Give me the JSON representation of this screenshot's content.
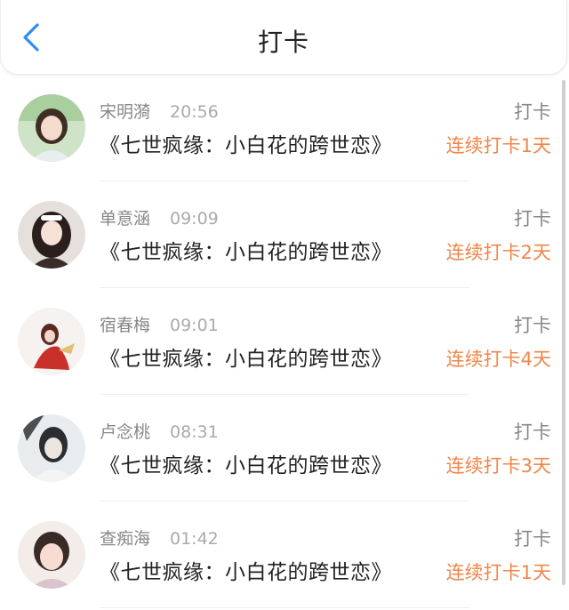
{
  "header": {
    "title": "打卡",
    "back_icon": "chevron-left-icon",
    "accent_color": "#2e8ef0"
  },
  "items": [
    {
      "name": "宋明漪",
      "time": "20:56",
      "book": "《七世疯缘：小白花的跨世恋》",
      "action": "打卡",
      "streak": "连续打卡1天"
    },
    {
      "name": "单意涵",
      "time": "09:09",
      "book": "《七世疯缘：小白花的跨世恋》",
      "action": "打卡",
      "streak": "连续打卡2天"
    },
    {
      "name": "宿春梅",
      "time": "09:01",
      "book": "《七世疯缘：小白花的跨世恋》",
      "action": "打卡",
      "streak": "连续打卡4天"
    },
    {
      "name": "卢念桃",
      "time": "08:31",
      "book": "《七世疯缘：小白花的跨世恋》",
      "action": "打卡",
      "streak": "连续打卡3天"
    },
    {
      "name": "查痴海",
      "time": "01:42",
      "book": "《七世疯缘：小白花的跨世恋》",
      "action": "打卡",
      "streak": "连续打卡1天"
    }
  ],
  "colors": {
    "streak": "#f0864a",
    "secondary_text": "#888888",
    "primary_text": "#222222"
  }
}
